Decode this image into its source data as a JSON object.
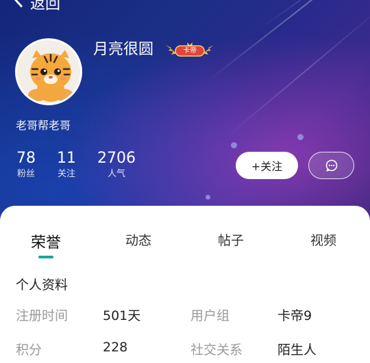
{
  "header": {
    "back_icon": "back-arrow-icon",
    "title_fragment": "返回"
  },
  "profile": {
    "username": "月亮很圆",
    "badge_text": "卡帝",
    "bio": "老哥帮老哥",
    "avatar_icon": "tiger-avatar-icon"
  },
  "stats": [
    {
      "value": "78",
      "label": "粉丝"
    },
    {
      "value": "11",
      "label": "关注"
    },
    {
      "value": "2706",
      "label": "人气"
    }
  ],
  "actions": {
    "follow_label": "+关注",
    "message_icon": "chat-bubble-icon"
  },
  "tabs": [
    {
      "label": "荣誉",
      "active": true
    },
    {
      "label": "动态",
      "active": false
    },
    {
      "label": "帖子",
      "active": false
    },
    {
      "label": "视频",
      "active": false
    }
  ],
  "info": {
    "section_title": "个人资料",
    "rows": [
      {
        "label1": "注册时间",
        "value1": "501天",
        "label2": "用户组",
        "value2": "卡帝9"
      },
      {
        "label1": "积分",
        "value1": "228",
        "label2": "社交关系",
        "value2": "陌生人"
      }
    ]
  },
  "colors": {
    "accent": "#1aa59a",
    "hero_dark": "#14257a",
    "hero_purple": "#3c2a8e",
    "badge_gold": "#e8b84a",
    "badge_red": "#e0453a"
  }
}
